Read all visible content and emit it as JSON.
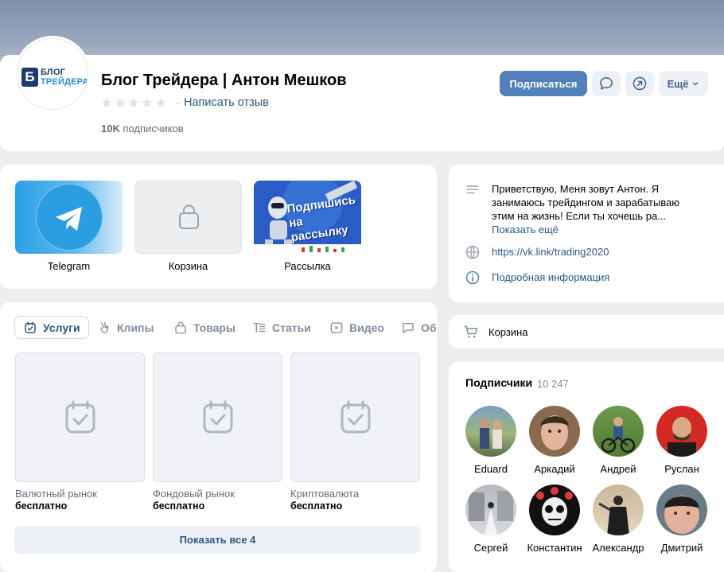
{
  "header": {
    "logo_line1": "БЛОГ",
    "logo_line2": "ТРЕЙДЕРА",
    "logo_letter": "Б",
    "title": "Блог Трейдера | Антон Мешков",
    "review_link": "Написать отзыв",
    "subscribers_count": "10K",
    "subscribers_label": "подписчиков",
    "subscribe_button": "Подписаться",
    "more_button": "Ещё",
    "rating_stars": 0
  },
  "links": [
    {
      "label": "Telegram",
      "icon": "telegram-icon"
    },
    {
      "label": "Корзина",
      "icon": "shopping-bag-icon"
    },
    {
      "label": "Рассылка",
      "icon": "newsletter-banner",
      "banner_text": "Подпишись на рассылку"
    }
  ],
  "tabs": [
    {
      "label": "Услуги",
      "icon": "services-icon",
      "active": true
    },
    {
      "label": "Клипы",
      "icon": "clips-icon",
      "active": false
    },
    {
      "label": "Товары",
      "icon": "bag-icon",
      "active": false
    },
    {
      "label": "Статьи",
      "icon": "articles-icon",
      "active": false
    },
    {
      "label": "Видео",
      "icon": "video-icon",
      "active": false
    },
    {
      "label": "Об",
      "icon": "discussions-icon",
      "active": false
    }
  ],
  "services": [
    {
      "name": "Валютный рынок",
      "price": "бесплатно"
    },
    {
      "name": "Фондовый рынок",
      "price": "бесплатно"
    },
    {
      "name": "Криптовалюта",
      "price": "бесплатно"
    }
  ],
  "show_all": "Показать все 4",
  "info": {
    "description": "Приветствую, Меня зовут Антон. Я занимаюсь трейдингом и зарабатываю этим на жизнь! Если ты хочешь ра...",
    "show_more": "Показать ещё",
    "website": "https://vk.link/trading2020",
    "details": "Подробная информация"
  },
  "basket": {
    "label": "Корзина"
  },
  "followers": {
    "title": "Подписчики",
    "count": "10 247",
    "people": [
      {
        "name": "Eduard"
      },
      {
        "name": "Аркадий"
      },
      {
        "name": "Андрей"
      },
      {
        "name": "Руслан"
      },
      {
        "name": "Сергей"
      },
      {
        "name": "Константин"
      },
      {
        "name": "Александр"
      },
      {
        "name": "Дмитрий"
      }
    ]
  },
  "colors": {
    "accent": "#5181b8",
    "link": "#2a5885",
    "background": "#edeef0",
    "muted": "#818c99"
  }
}
